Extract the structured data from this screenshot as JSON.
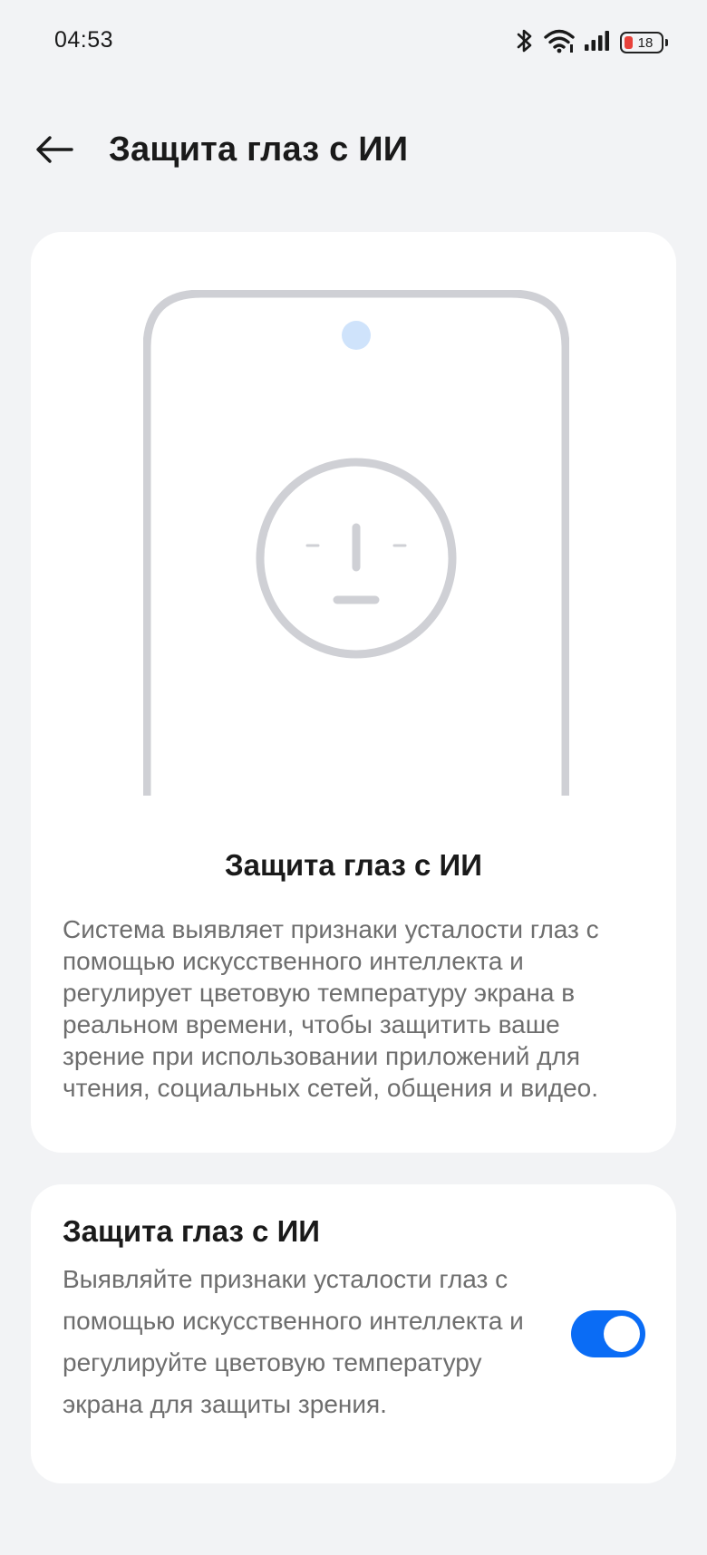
{
  "status_bar": {
    "time": "04:53",
    "battery_level": "18",
    "icons": [
      "bluetooth-icon",
      "wifi-icon",
      "signal-icon",
      "battery-icon"
    ],
    "battery_color": "#e8413a"
  },
  "header": {
    "back_icon": "back-arrow-icon",
    "title": "Защита глаз с ИИ"
  },
  "hero": {
    "illustration": "phone-face-illustration",
    "title": "Защита глаз с ИИ",
    "description": "Система выявляет признаки усталости глаз с помощью искусственного интеллекта и регулирует цветовую температуру экрана в реальном времени, чтобы защитить ваше зрение при использовании приложений для чтения, социальных сетей, общения и видео."
  },
  "setting": {
    "title": "Защита глаз с ИИ",
    "description": "Выявляйте признаки усталости глаз с помощью искусственного интеллекта и регулируйте цветовую температуру экрана для защиты зрения.",
    "enabled": true,
    "accent_color": "#0a6cf5"
  }
}
